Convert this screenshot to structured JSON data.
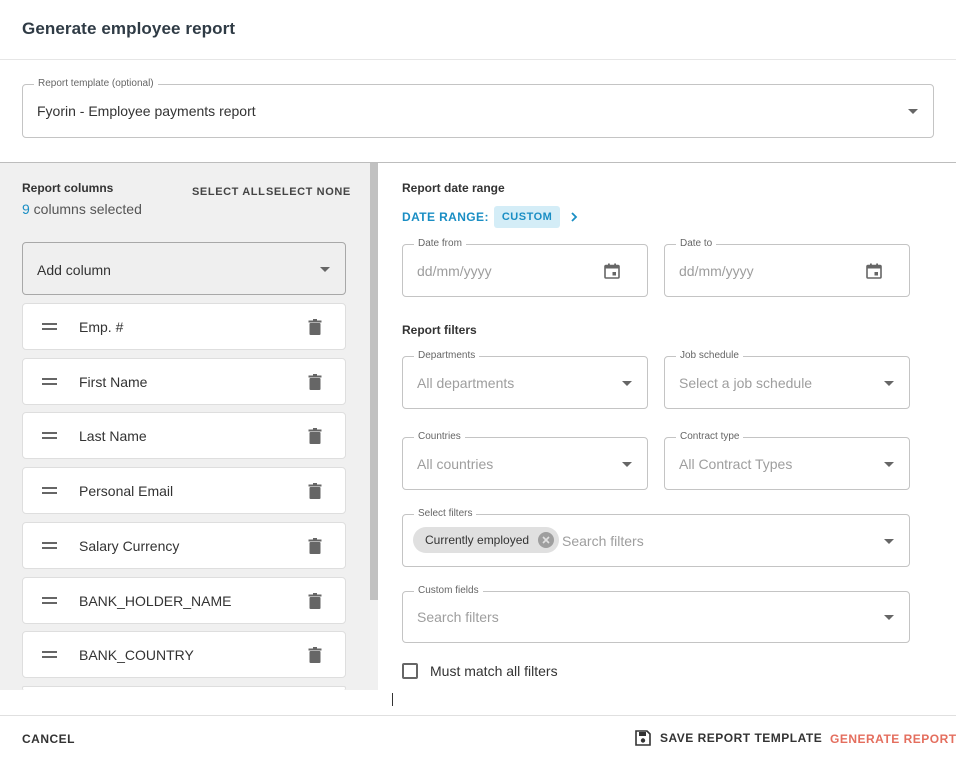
{
  "dialog": {
    "title": "Generate employee report"
  },
  "template": {
    "label": "Report template (optional)",
    "value": "Fyorin - Employee payments report"
  },
  "columns": {
    "title": "Report columns",
    "count": "9",
    "count_suffix": " columns selected",
    "select_all": "SELECT ALL",
    "select_none": "SELECT NONE",
    "add_column": "Add column",
    "items": [
      {
        "label": "Emp. #"
      },
      {
        "label": "First Name"
      },
      {
        "label": "Last Name"
      },
      {
        "label": "Personal Email"
      },
      {
        "label": "Salary Currency"
      },
      {
        "label": "BANK_HOLDER_NAME"
      },
      {
        "label": "BANK_COUNTRY"
      }
    ]
  },
  "date_range": {
    "title": "Report date range",
    "label": "DATE RANGE:",
    "value": "CUSTOM",
    "from_label": "Date from",
    "from_placeholder": "dd/mm/yyyy",
    "to_label": "Date to",
    "to_placeholder": "dd/mm/yyyy"
  },
  "filters": {
    "title": "Report filters",
    "departments": {
      "label": "Departments",
      "placeholder": "All departments"
    },
    "job_schedule": {
      "label": "Job schedule",
      "placeholder": "Select a job schedule"
    },
    "countries": {
      "label": "Countries",
      "placeholder": "All countries"
    },
    "contract_type": {
      "label": "Contract type",
      "placeholder": "All Contract Types"
    },
    "select_filters": {
      "label": "Select filters",
      "chip": "Currently employed",
      "placeholder": "Search filters"
    },
    "custom_fields": {
      "label": "Custom fields",
      "placeholder": "Search filters"
    },
    "match_all": "Must match all filters"
  },
  "footer": {
    "cancel": "CANCEL",
    "save_template": "SAVE REPORT TEMPLATE",
    "generate": "GENERATE REPORT"
  },
  "colors": {
    "accent": "#1a8ec4",
    "danger": "#e46e5e",
    "panel_bg": "#f0f0f0"
  },
  "icons": {
    "drag": "drag-handle-icon",
    "delete": "trash-icon",
    "calendar": "calendar-icon",
    "chip_remove": "close-circle-icon",
    "save": "floppy-disk-icon",
    "dropdown": "caret-down-icon",
    "next": "chevron-right-icon"
  }
}
